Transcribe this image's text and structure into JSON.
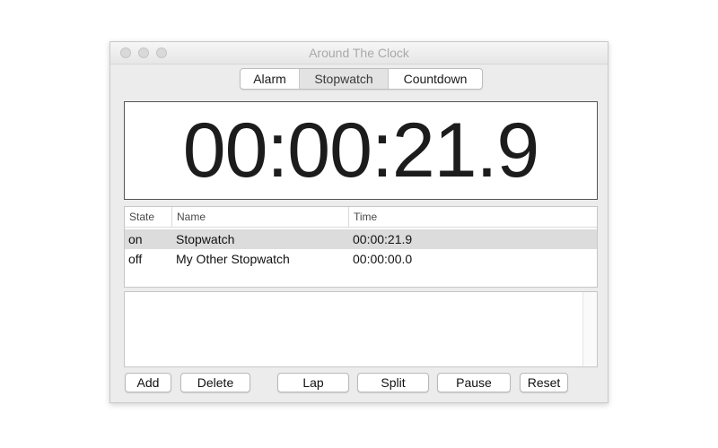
{
  "window": {
    "title": "Around The Clock"
  },
  "tabs": [
    {
      "label": "Alarm",
      "selected": false
    },
    {
      "label": "Stopwatch",
      "selected": true
    },
    {
      "label": "Countdown",
      "selected": false
    }
  ],
  "display": {
    "time": "00:00:21.9"
  },
  "table": {
    "columns": [
      "State",
      "Name",
      "Time"
    ],
    "rows": [
      {
        "state": "on",
        "name": "Stopwatch",
        "time": "00:00:21.9",
        "selected": true
      },
      {
        "state": "off",
        "name": "My Other Stopwatch",
        "time": "00:00:00.0",
        "selected": false
      }
    ]
  },
  "buttons": {
    "add": "Add",
    "delete": "Delete",
    "lap": "Lap",
    "split": "Split",
    "pause": "Pause",
    "reset": "Reset"
  },
  "colors": {
    "window_bg": "#ececec",
    "selected_row": "#dcdcdc",
    "title_text": "#a9a9a9"
  },
  "icons": {
    "close": "close-icon",
    "minimize": "minimize-icon",
    "zoom": "zoom-icon"
  }
}
